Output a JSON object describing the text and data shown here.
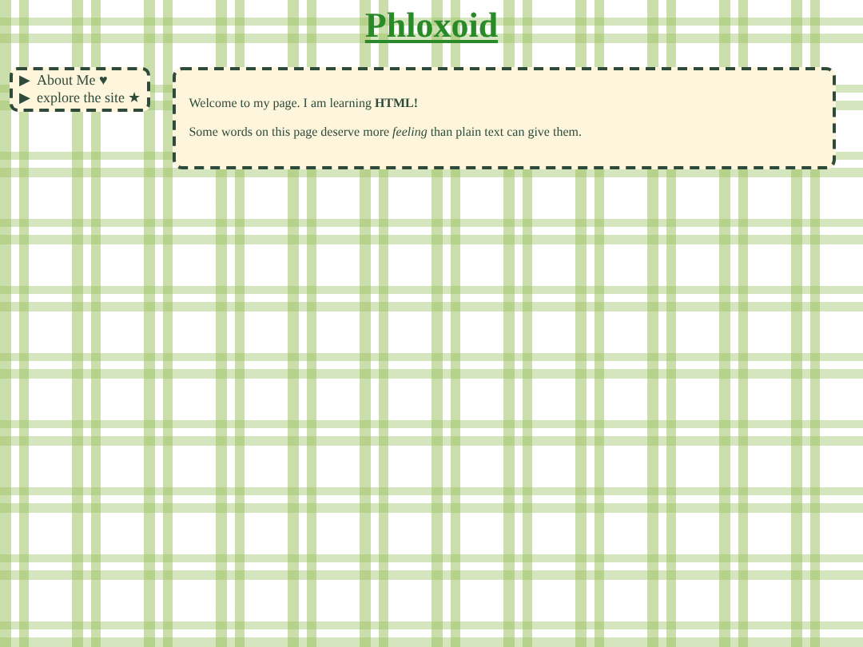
{
  "title": "Phloxoid",
  "nav": [
    {
      "marker": "▶",
      "label": "About Me ♥"
    },
    {
      "marker": "▶",
      "label": "explore the site ★"
    }
  ],
  "paragraphs": [
    "Welcome to my page. I am learning **HTML!**",
    "Some words on this page deserve more *feeling* than plain text can give them."
  ]
}
